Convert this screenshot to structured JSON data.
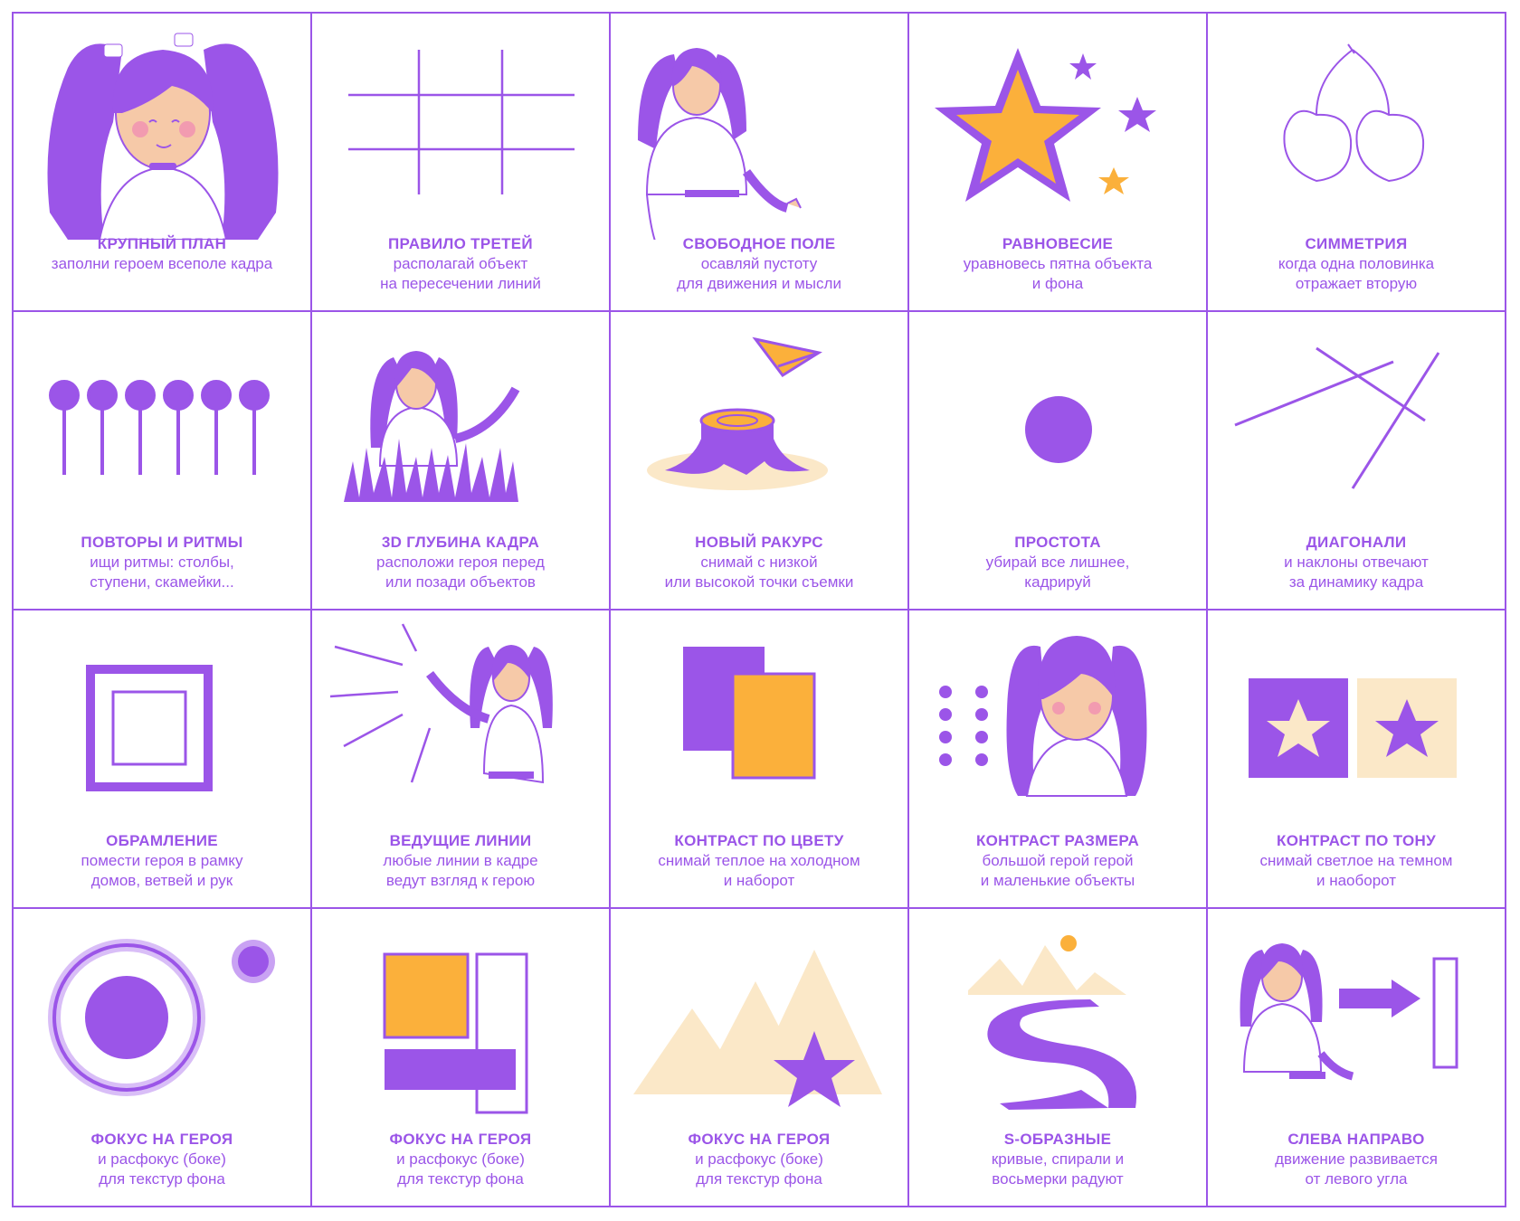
{
  "colors": {
    "purple": "#9b55e8",
    "orange": "#fbb03b",
    "cream": "#fbe8c8",
    "skin": "#f6c9a8",
    "cheek": "#f29bb0"
  },
  "cards": [
    {
      "title": "КРУПНЫЙ ПЛАН",
      "line1": "заполни героем всеполе кадра",
      "line2": "",
      "icon": "close-up-girl-icon"
    },
    {
      "title": "ПРАВИЛО ТРЕТЕЙ",
      "line1": "располагай объект",
      "line2": "на пересечении линий",
      "icon": "grid-lines-icon"
    },
    {
      "title": "СВОБОДНОЕ ПОЛЕ",
      "line1": "осавляй пустоту",
      "line2": "для движения и мысли",
      "icon": "girl-pointing-icon"
    },
    {
      "title": "РАВНОВЕСИЕ",
      "line1": "уравновесь пятна объекта",
      "line2": "и фона",
      "icon": "star-balance-icon"
    },
    {
      "title": "СИММЕТРИЯ",
      "line1": "когда одна половинка",
      "line2": "отражает вторую",
      "icon": "cherry-icon"
    },
    {
      "title": "ПОВТОРЫ И РИТМЫ",
      "line1": "ищи ритмы: столбы,",
      "line2": "ступени, скамейки...",
      "icon": "lollipops-icon"
    },
    {
      "title": "3D ГЛУБИНА КАДРА",
      "line1": "расположи героя перед",
      "line2": "или позади объектов",
      "icon": "girl-in-grass-icon"
    },
    {
      "title": "НОВЫЙ РАКУРС",
      "line1": "снимай с низкой",
      "line2": "или высокой точки съемки",
      "icon": "stump-plane-icon"
    },
    {
      "title": "ПРОСТОТА",
      "line1": "убирай все лишнее,",
      "line2": "кадрируй",
      "icon": "circle-icon"
    },
    {
      "title": "ДИАГОНАЛИ",
      "line1": "и наклоны отвечают",
      "line2": "за динамику кадра",
      "icon": "diagonal-lines-icon"
    },
    {
      "title": "ОБРАМЛЕНИЕ",
      "line1": "помести героя в рамку",
      "line2": "домов, ветвей и рук",
      "icon": "frame-icon"
    },
    {
      "title": "ВЕДУЩИЕ ЛИНИИ",
      "line1": "любые линии в кадре",
      "line2": "ведут взгляд к герою",
      "icon": "leading-lines-girl-icon"
    },
    {
      "title": "КОНТРАСТ ПО ЦВЕТУ",
      "line1": "снимай теплое на холодном",
      "line2": "и наборот",
      "icon": "color-contrast-icon"
    },
    {
      "title": "КОНТРАСТ РАЗМЕРА",
      "line1": "большой герой герой",
      "line2": "и маленькие объекты",
      "icon": "size-contrast-icon"
    },
    {
      "title": "КОНТРАСТ ПО ТОНУ",
      "line1": "снимай светлое на темном",
      "line2": "и наоборот",
      "icon": "tone-contrast-icon"
    },
    {
      "title": "ФОКУС НА ГЕРОЯ",
      "line1": "и расфокус (боке)",
      "line2": "для текстур фона",
      "icon": "bokeh-icon"
    },
    {
      "title": "ФОКУС НА ГЕРОЯ",
      "line1": "и расфокус (боке)",
      "line2": "для текстур фона",
      "icon": "blocks-icon"
    },
    {
      "title": "ФОКУС НА ГЕРОЯ",
      "line1": "и расфокус (боке)",
      "line2": "для текстур фона",
      "icon": "mountains-star-icon"
    },
    {
      "title": "S-ОБРАЗНЫЕ",
      "line1": "кривые, спирали и",
      "line2": "восьмерки радуют",
      "icon": "s-road-icon"
    },
    {
      "title": "СЛЕВА НАПРАВО",
      "line1": "движение развивается",
      "line2": "от левого угла",
      "icon": "girl-arrow-icon"
    }
  ]
}
